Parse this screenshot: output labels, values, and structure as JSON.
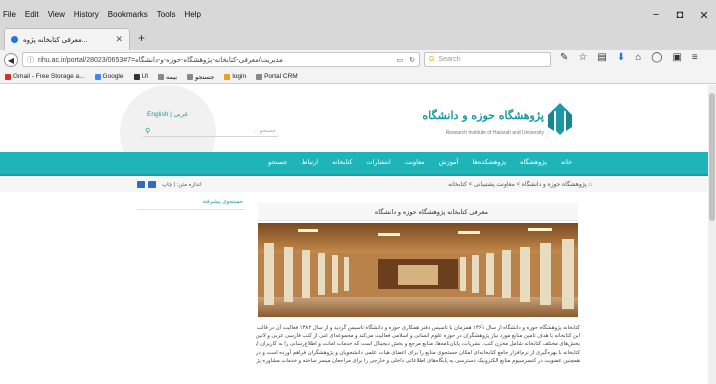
{
  "browser": {
    "menu": [
      "File",
      "Edit",
      "View",
      "History",
      "Bookmarks",
      "Tools",
      "Help"
    ],
    "window_controls": [
      "−",
      "◘",
      "✕"
    ],
    "tab": {
      "title": "...معرفی کتابخانه پژوه",
      "close": "✕"
    },
    "new_tab": "+",
    "url": "rihu.ac.ir/portal/28023/مدیریت/معرفی-کتابخانه-پژوهشگاه-حوزه-و-دانشگاه=7#0653",
    "search_placeholder": "Search",
    "bookmarks": [
      {
        "label": "Gmail - Free Storage a...",
        "icon_color": "#d93025"
      },
      {
        "label": "Google",
        "icon_color": "#4285f4"
      },
      {
        "label": "UI",
        "icon_color": "#333333"
      },
      {
        "label": "بیمه",
        "icon_color": "#888888"
      },
      {
        "label": "جستجو",
        "icon_color": "#888888"
      },
      {
        "label": "login",
        "icon_color": "#e8a317"
      },
      {
        "label": "Portal CRM",
        "icon_color": "#888888"
      }
    ]
  },
  "site": {
    "logo_text": "پژوهشگاه حوزه و دانشگاه",
    "logo_sub": "Research Institute of Hawzah and University",
    "lang_link": "English | عربی",
    "search_placeholder": "جستجو ...",
    "nav": [
      "خانه",
      "پژوهشگاه",
      "پژوهشکده‌ها",
      "آموزش",
      "معاونت",
      "انتشارات",
      "کتابخانه",
      "ارتباط",
      "جستجو"
    ],
    "breadcrumb": "پژوهشگاه حوزه و دانشگاه > معاونت پشتیبانی > کتابخانه",
    "tools_text": "اندازه متن: | چاپ",
    "side_label": "جستجوی پیشرفته",
    "article_title": "معرفی کتابخانه پژوهشگاه حوزه و دانشگاه",
    "article_body": [
      "کتابخانه پژوهشگاه حوزه و دانشگاه از سال ۱۳۶۱ همزمان با تاسیس دفتر همکاری حوزه و دانشگاه تاسیس گردید و از سال ۱۳۸۲ فعالیت آن در قالب کتابخانه پژوهشگاه ادامه یافت",
      "این کتابخانه با هدف تامین منابع مورد نیاز پژوهشگران در حوزه علوم انسانی و اسلامی فعالیت می‌کند و مجموعه‌ای غنی از کتب فارسی عربی و لاتین را در اختیار دارد",
      "بخش‌های مختلف کتابخانه شامل مخزن کتب، نشریات، پایان‌نامه‌ها، منابع مرجع و بخش دیجیتال است که خدمات امانت و اطلاع‌رسانی را به کاربران ارائه می‌دهند",
      "کتابخانه با بهره‌گیری از نرم‌افزار جامع کتابخانه‌ای امکان جستجوی منابع را برای اعضای هیات علمی دانشجویان و پژوهشگران فراهم آورده است و در حال توسعه است",
      "همچنین عضویت در کنسرسیوم منابع الکترونیک دسترسی به پایگاه‌های اطلاعاتی داخلی و خارجی را برای مراجعان میسر ساخته و خدمات مشاوره پژوهشی نیز ارائه می‌شود"
    ]
  },
  "colors": {
    "accent": "#1eb4b8",
    "link": "#1b9aa5",
    "chrome": "#d8d8d8"
  }
}
